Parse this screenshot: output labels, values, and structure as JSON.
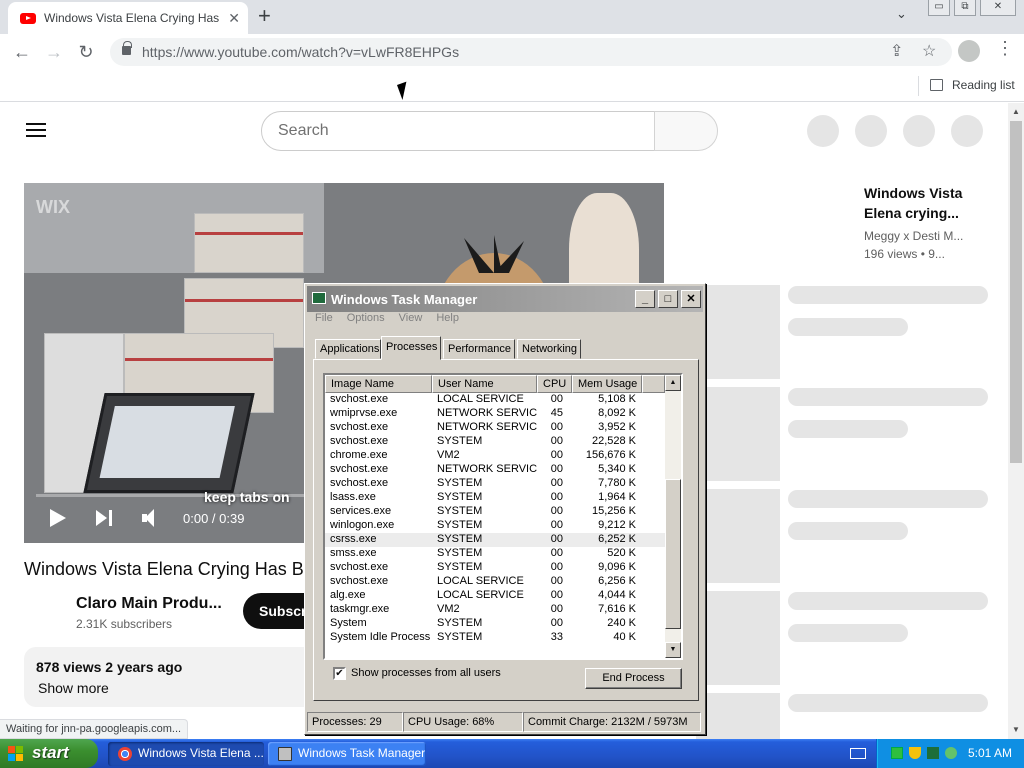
{
  "browser": {
    "tab_title": "Windows Vista Elena Crying Has BSOD",
    "tab_close": "✕",
    "new_tab": "+",
    "tab_dropdown": "⌄",
    "window_controls": [
      "▭",
      "⧉",
      "✕"
    ],
    "url": "https://www.youtube.com/watch?v=vLwFR8EHPGs",
    "nav": {
      "back": "←",
      "forward": "→",
      "reload": "↻"
    },
    "share": "⇪",
    "star": "☆",
    "menu": "⋮",
    "reading_list": "Reading list",
    "status_text": "Waiting for jnn-pa.googleapis.com..."
  },
  "youtube": {
    "search_placeholder": "Search",
    "video": {
      "watermark": "WIX",
      "caption": "keep tabs on",
      "time": "0:00 / 0:39",
      "progress": 0
    },
    "title": "Windows Vista Elena Crying Has BSOD",
    "channel": "Claro Main Produ...",
    "subscribers": "2.31K subscribers",
    "subscribe_label": "Subscribe",
    "views_meta": "878 views  2 years ago",
    "show_more": "Show more",
    "recommended": {
      "title": "Windows Vista Elena crying...",
      "channel": "Meggy x Desti M...",
      "meta": "196 views • 9..."
    }
  },
  "task_manager": {
    "title": "Windows Task Manager",
    "controls": [
      "_",
      "□",
      "✕"
    ],
    "menu": [
      "File",
      "Options",
      "View",
      "Help"
    ],
    "tabs": [
      "Applications",
      "Processes",
      "Performance",
      "Networking"
    ],
    "active_tab": "Processes",
    "columns": [
      "Image Name",
      "User Name",
      "CPU",
      "Mem Usage"
    ],
    "processes": [
      {
        "name": "svchost.exe",
        "user": "LOCAL SERVICE",
        "cpu": "00",
        "mem": "5,108 K"
      },
      {
        "name": "wmiprvse.exe",
        "user": "NETWORK SERVICE",
        "cpu": "45",
        "mem": "8,092 K"
      },
      {
        "name": "svchost.exe",
        "user": "NETWORK SERVICE",
        "cpu": "00",
        "mem": "3,952 K"
      },
      {
        "name": "svchost.exe",
        "user": "SYSTEM",
        "cpu": "00",
        "mem": "22,528 K"
      },
      {
        "name": "chrome.exe",
        "user": "VM2",
        "cpu": "00",
        "mem": "156,676 K"
      },
      {
        "name": "svchost.exe",
        "user": "NETWORK SERVICE",
        "cpu": "00",
        "mem": "5,340 K"
      },
      {
        "name": "svchost.exe",
        "user": "SYSTEM",
        "cpu": "00",
        "mem": "7,780 K"
      },
      {
        "name": "lsass.exe",
        "user": "SYSTEM",
        "cpu": "00",
        "mem": "1,964 K"
      },
      {
        "name": "services.exe",
        "user": "SYSTEM",
        "cpu": "00",
        "mem": "15,256 K"
      },
      {
        "name": "winlogon.exe",
        "user": "SYSTEM",
        "cpu": "00",
        "mem": "9,212 K"
      },
      {
        "name": "csrss.exe",
        "user": "SYSTEM",
        "cpu": "00",
        "mem": "6,252 K"
      },
      {
        "name": "smss.exe",
        "user": "SYSTEM",
        "cpu": "00",
        "mem": "520 K"
      },
      {
        "name": "svchost.exe",
        "user": "SYSTEM",
        "cpu": "00",
        "mem": "9,096 K"
      },
      {
        "name": "svchost.exe",
        "user": "LOCAL SERVICE",
        "cpu": "00",
        "mem": "6,256 K"
      },
      {
        "name": "alg.exe",
        "user": "LOCAL SERVICE",
        "cpu": "00",
        "mem": "4,044 K"
      },
      {
        "name": "taskmgr.exe",
        "user": "VM2",
        "cpu": "00",
        "mem": "7,616 K"
      },
      {
        "name": "System",
        "user": "SYSTEM",
        "cpu": "00",
        "mem": "240 K"
      },
      {
        "name": "System Idle Process",
        "user": "SYSTEM",
        "cpu": "33",
        "mem": "40 K"
      }
    ],
    "selected_process": "csrss.exe",
    "show_all_users_label": "Show processes from all users",
    "show_all_users_checked": true,
    "end_process_label": "End Process",
    "status": {
      "processes": "Processes: 29",
      "cpu": "CPU Usage: 68%",
      "commit": "Commit Charge: 2132M / 5973M"
    }
  },
  "taskbar": {
    "start_label": "start",
    "buttons": [
      "Windows Vista Elena ...",
      "Windows Task Manager"
    ],
    "clock": "5:01 AM"
  },
  "colors": {
    "youtube_red": "#ff0000",
    "xp_taskbar_blue": "#245edb",
    "xp_start_green": "#3b8f2f",
    "classic_title_blue": "#0a246a",
    "classic_face": "#d4d0c8",
    "skeleton_gray": "#e5e5e5"
  }
}
